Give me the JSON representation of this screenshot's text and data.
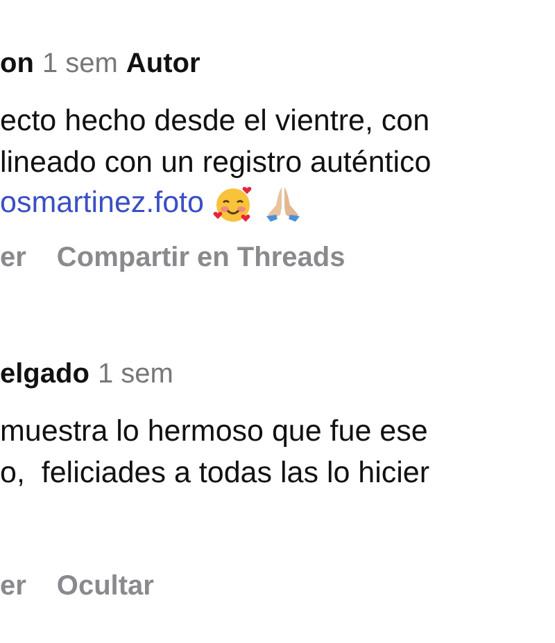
{
  "comments": [
    {
      "username": "on",
      "time": "1 sem",
      "badge": "Autor",
      "lines": [
        {
          "text": "ecto hecho desde el vientre, con",
          "kind": "plain"
        },
        {
          "text": "lineado con un registro auténtico",
          "kind": "plain"
        },
        {
          "text": "osmartinez.foto",
          "kind": "mention"
        }
      ],
      "emoji": true,
      "actions": [
        "er",
        "Compartir en Threads"
      ]
    },
    {
      "username": "elgado",
      "time": "1 sem",
      "lines": [
        {
          "text": "muestra lo hermoso que fue ese",
          "kind": "plain"
        },
        {
          "text": "o,  feliciades a todas las lo hicier",
          "kind": "plain"
        }
      ],
      "emoji": false,
      "actions": [
        "er",
        "Ocultar"
      ]
    }
  ]
}
